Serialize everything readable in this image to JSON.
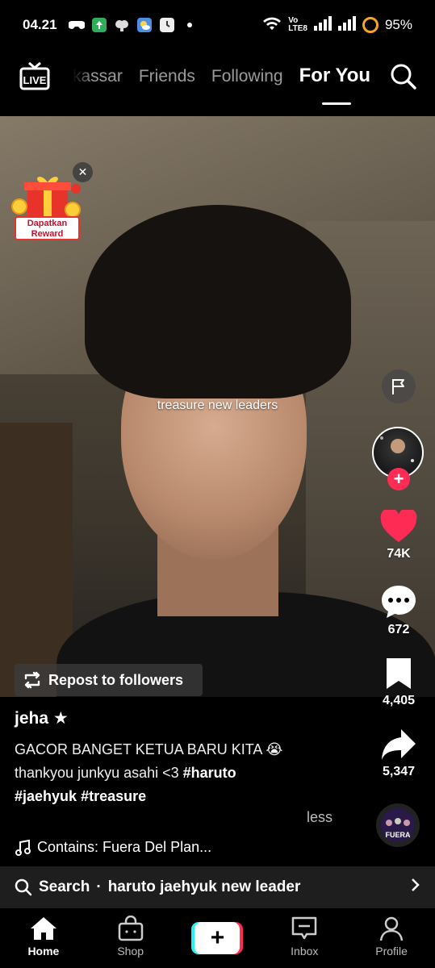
{
  "status_bar": {
    "time": "04.21",
    "network_label_top": "Vo",
    "network_label_bottom": "LTE8",
    "battery": "95%"
  },
  "top_nav": {
    "live_label": "LIVE",
    "tabs": [
      "kassar",
      "Friends",
      "Following",
      "For You"
    ],
    "active_tab": "For You"
  },
  "reward": {
    "label": "Dapatkan Reward"
  },
  "video": {
    "overlay_text": "treasure new leaders"
  },
  "actions": {
    "likes": "74K",
    "comments": "672",
    "bookmarks": "4,405",
    "shares": "5,347",
    "colors": {
      "like": "#fe2c55",
      "follow": "#fe2c55"
    }
  },
  "repost": {
    "label": "Repost to followers"
  },
  "post": {
    "author": "jeha ★",
    "desc_line1": "GACOR BANGET KETUA BARU KITA 😭",
    "desc_line2_text": "thankyou junkyu asahi <3 ",
    "hashtag_haruto": "#haruto",
    "hashtag_jaehyuk": "#jaehyuk",
    "hashtag_treasure": "#treasure",
    "less_label": "less",
    "music": "Contains: Fuera Del Plan..."
  },
  "music_disc": {
    "label": "FUERA"
  },
  "search": {
    "prefix": "Search",
    "query": "haruto jaehyuk new leader"
  },
  "bottom_nav": {
    "home": "Home",
    "shop": "Shop",
    "inbox": "Inbox",
    "profile": "Profile"
  }
}
